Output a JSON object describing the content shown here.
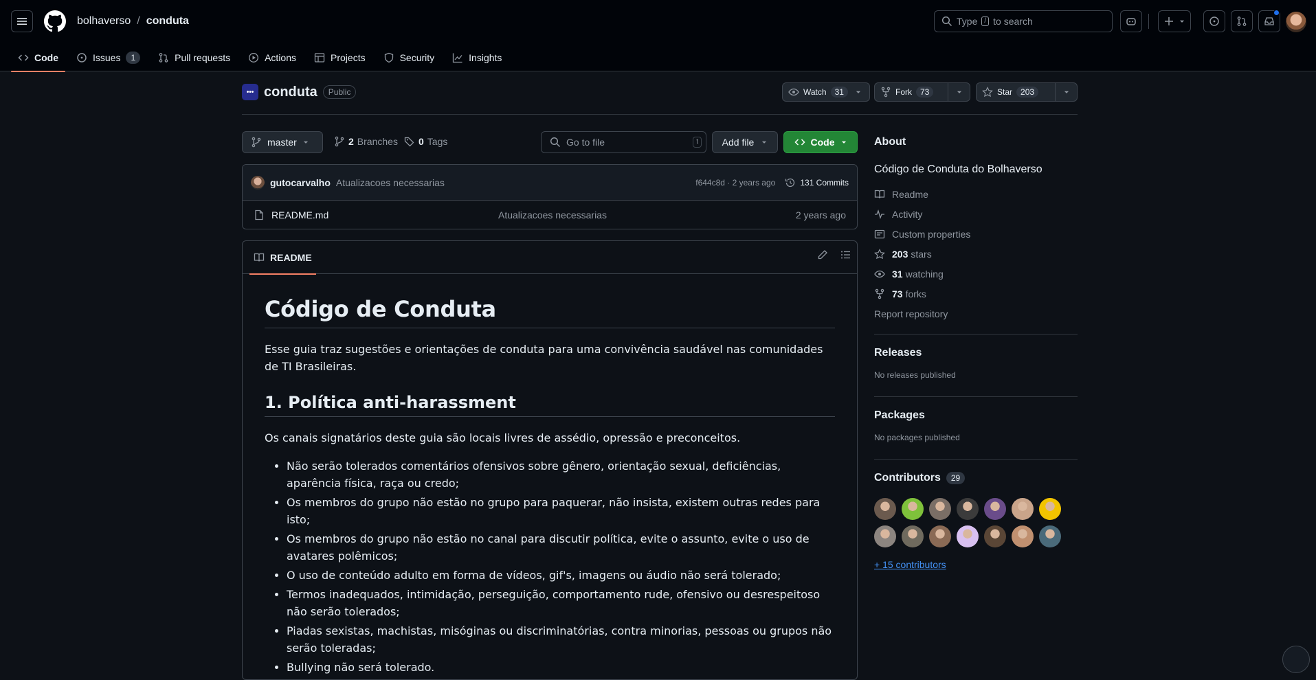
{
  "header": {
    "owner": "bolhaverso",
    "separator": "/",
    "repo": "conduta",
    "search_prefix": "Type",
    "search_key": "/",
    "search_suffix": "to search"
  },
  "tabs": [
    {
      "label": "Code",
      "icon": "code-icon"
    },
    {
      "label": "Issues",
      "count": "1",
      "icon": "issue-icon"
    },
    {
      "label": "Pull requests",
      "icon": "pull-request-icon"
    },
    {
      "label": "Actions",
      "icon": "play-icon"
    },
    {
      "label": "Projects",
      "icon": "table-icon"
    },
    {
      "label": "Security",
      "icon": "shield-icon"
    },
    {
      "label": "Insights",
      "icon": "graph-icon"
    }
  ],
  "repo": {
    "avatar_text": "•••",
    "name": "conduta",
    "visibility": "Public",
    "watch_label": "Watch",
    "watch_count": "31",
    "fork_label": "Fork",
    "fork_count": "73",
    "star_label": "Star",
    "star_count": "203"
  },
  "toolbar": {
    "branch": "master",
    "branches_count": "2",
    "branches_label": "Branches",
    "tags_count": "0",
    "tags_label": "Tags",
    "goto_placeholder": "Go to file",
    "goto_key": "t",
    "add_file": "Add file",
    "code": "Code"
  },
  "commit": {
    "user": "gutocarvalho",
    "message": "Atualizacoes necessarias",
    "hash_time": "f644c8d · 2 years ago",
    "commits": "131 Commits"
  },
  "files": [
    {
      "name": "README.md",
      "message": "Atualizacoes necessarias",
      "date": "2 years ago"
    }
  ],
  "readme": {
    "tab": "README",
    "h1": "Código de Conduta",
    "intro": "Esse guia traz sugestões e orientações de conduta para uma convivência saudável nas comunidades de TI Brasileiras.",
    "h2": "1. Política anti-harassment",
    "p2": "Os canais signatários deste guia são locais livres de assédio, opressão e preconceitos.",
    "bullets": [
      "Não serão tolerados comentários ofensivos sobre gênero, orientação sexual, deficiências, aparência física, raça ou credo;",
      "Os membros do grupo não estão no grupo para paquerar, não insista, existem outras redes para isto;",
      "Os membros do grupo não estão no canal para discutir política, evite o assunto, evite o uso de avatares polêmicos;",
      "O uso de conteúdo adulto em forma de vídeos, gif's, imagens ou áudio não será tolerado;",
      "Termos inadequados, intimidação, perseguição, comportamento rude, ofensivo ou desrespeitoso não serão tolerados;",
      "Piadas sexistas, machistas, misóginas ou discriminatórias, contra minorias, pessoas ou grupos não serão toleradas;",
      "Bullying não será tolerado."
    ]
  },
  "about": {
    "title": "About",
    "description": "Código de Conduta do Bolhaverso",
    "readme": "Readme",
    "activity": "Activity",
    "custom_properties": "Custom properties",
    "stars_count": "203",
    "stars_label": "stars",
    "watching_count": "31",
    "watching_label": "watching",
    "forks_count": "73",
    "forks_label": "forks",
    "report": "Report repository"
  },
  "releases": {
    "title": "Releases",
    "empty": "No releases published"
  },
  "packages": {
    "title": "Packages",
    "empty": "No packages published"
  },
  "contributors": {
    "title": "Contributors",
    "count": "29",
    "more": "+ 15 contributors",
    "avatar_colors": [
      "#6b5a4e",
      "#7fc13b",
      "#7a6e66",
      "#3b3b3b",
      "#6a4c8a",
      "#c9a48a",
      "#f2c400",
      "#8c8580",
      "#6f6a5e",
      "#8a6a55",
      "#d8c0f0",
      "#5a4636",
      "#c09070",
      "#4a6a7a"
    ]
  },
  "colors": {
    "accent": "#f78166",
    "link": "#4493f8",
    "green": "#238636"
  }
}
